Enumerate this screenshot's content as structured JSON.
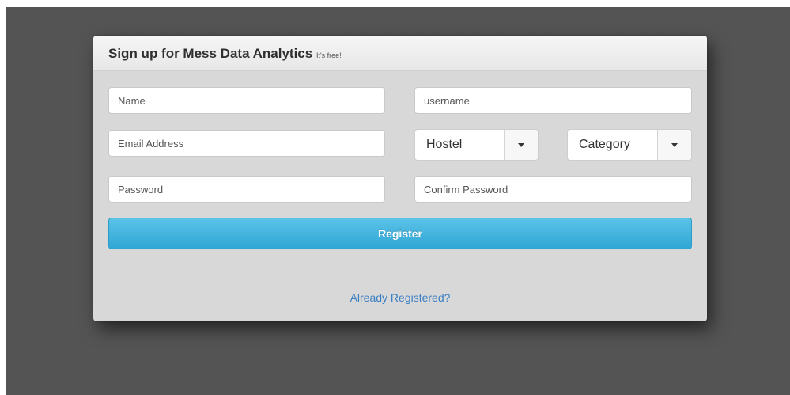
{
  "form": {
    "title": "Sign up for Mess Data Analytics",
    "subtitle": "It's free!",
    "fields": {
      "name": {
        "placeholder": "Name",
        "value": ""
      },
      "username": {
        "placeholder": "username",
        "value": ""
      },
      "email": {
        "placeholder": "Email Address",
        "value": ""
      },
      "password": {
        "placeholder": "Password",
        "value": ""
      },
      "confirm_password": {
        "placeholder": "Confirm Password",
        "value": ""
      }
    },
    "selects": {
      "hostel": {
        "selected": "Hostel"
      },
      "category": {
        "selected": "Category"
      }
    },
    "register_label": "Register",
    "login_link": "Already Registered?"
  },
  "colors": {
    "backdrop": "#545454",
    "panel": "#d8d8d8",
    "primary_button": "#2fa6d5",
    "link": "#3b7fc4"
  },
  "icons": {
    "select_caret": "chevron-down-icon"
  }
}
